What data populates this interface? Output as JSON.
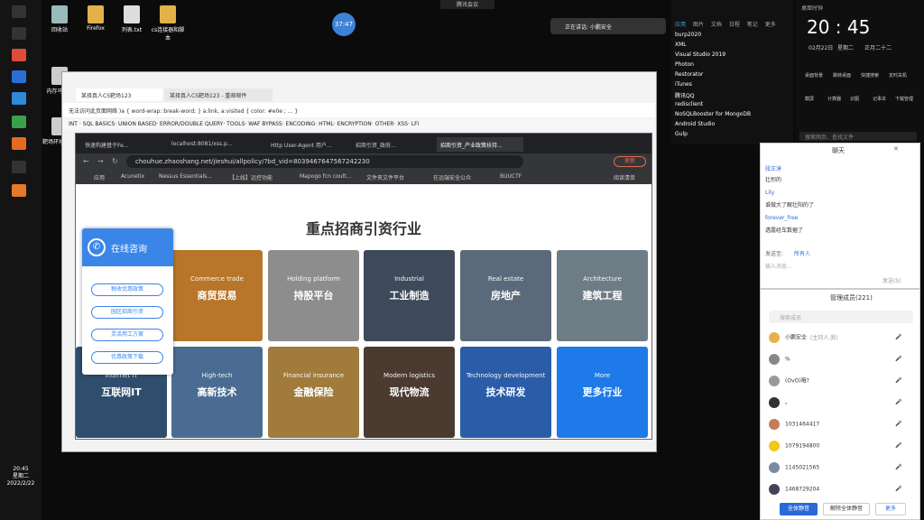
{
  "desktop_icons": [
    "回收站",
    "Firefox",
    "列表.txt",
    "cs连接器和脚本",
    "内存马.jpg",
    "靶场环境\n命令"
  ],
  "tray": {
    "time": "20:45",
    "weekday": "星期二",
    "date": "2022/2/22"
  },
  "meeting": {
    "bar_label": "腾讯会议",
    "timer": "37:47",
    "speaking": "正在讲话: 小鹏安全"
  },
  "outer_browser": {
    "tabs": [
      "某择真人CS靶场123",
      "某择真人CS靶场123 - 重邮邮件"
    ],
    "address": "无法访问此页面网络 )a { word-wrap: break-word; } a:link, a:visited { color: #e0e ; ... }",
    "hackbar": "INT · SQL BASICS· UNION BASED· ERROR/DOUBLE QUERY· TOOLS· WAF BYPASS· ENCODING· HTML· ENCRYPTION· OTHER· XSS· LFI"
  },
  "inner_browser": {
    "tabs": [
      "快速构建基于Fe...",
      "localhost:8081/xss.p...",
      "Http User-Agent 用户...",
      "招商引资_政府...",
      "招商引资_产业政策扶持..."
    ],
    "url": "chouhue.zhaoshang.net/jieshui/allpolicy/?bd_vid=8039467647567242230",
    "bookmarks": [
      "应用",
      "Acunetix",
      "Nessus Essentials...",
      "【上线】远控功能",
      "Mapogo fcn coult...",
      "文件夹文件平台",
      "在远端安全公众",
      "BUUCTF",
      "阅读清单"
    ],
    "update_label": "更新"
  },
  "page": {
    "title": "重点招商引资行业",
    "tiles": [
      {
        "en": "Commerce trade",
        "zh": "商贸贸易",
        "color": "#b8762a"
      },
      {
        "en": "Holding platform",
        "zh": "持股平台",
        "color": "#8d8d8d"
      },
      {
        "en": "Industrial",
        "zh": "工业制造",
        "color": "#3e4a5a"
      },
      {
        "en": "Real estate",
        "zh": "房地产",
        "color": "#5a6a7a"
      },
      {
        "en": "Architecture",
        "zh": "建筑工程",
        "color": "#6e7c86"
      },
      {
        "en": "Internet IT",
        "zh": "互联网IT",
        "color": "#2f4e6e"
      },
      {
        "en": "High-tech",
        "zh": "高新技术",
        "color": "#4a6c92"
      },
      {
        "en": "Financial insurance",
        "zh": "金融保险",
        "color": "#a07b3c"
      },
      {
        "en": "Modern logistics",
        "zh": "现代物流",
        "color": "#4a3a30"
      },
      {
        "en": "Technology development",
        "zh": "技术研发",
        "color": "#2a5ca8"
      },
      {
        "en": "More",
        "zh": "更多行业",
        "color": "#1e7ae8"
      }
    ],
    "consult": {
      "title": "在线咨询",
      "buttons": [
        "税收优惠政策",
        "园区招商引资",
        "灵活用工方案",
        "优惠政策下载"
      ]
    }
  },
  "apps_panel": {
    "tabs": [
      "应用",
      "图片",
      "文档",
      "日程",
      "笔记",
      "更多"
    ],
    "items": [
      "burp2020",
      "XML",
      "Visual Studio 2019",
      "Photon",
      "Restorator",
      "iTunes",
      "腾讯QQ",
      "redisclient",
      "NoSQLBooster for MongoDB",
      "Android Studio",
      "Gulp"
    ]
  },
  "clock_panel": {
    "title": "桌面时钟",
    "time": "20 : 45",
    "date": "02月22日",
    "weekday": "星期二",
    "lunar": "正月二十二",
    "actions": [
      "桌面背景",
      "跳转桌面",
      "快捷搜索",
      "定时关机",
      "截屏",
      "计算器",
      "识图",
      "记事本",
      "下载管理"
    ],
    "search_placeholder": "搜索网页、查找文件"
  },
  "chat": {
    "title": "聊天",
    "messages": [
      {
        "name": "段正淳",
        "text": "壮烈的"
      },
      {
        "name": "Lily",
        "text": "谁做大了解壮阳的了"
      },
      {
        "name": "forever_free",
        "text": "透露经车数据了"
      }
    ],
    "send_to_label": "发送至:",
    "send_to": "所有人",
    "input_placeholder": "输入消息...",
    "send_button": "发送(S)"
  },
  "members": {
    "title": "管理成员(221)",
    "search_placeholder": "搜索成员",
    "rows": [
      {
        "name": "小鹏安全",
        "sub": "(主持人,我)",
        "color": "#e8b04a"
      },
      {
        "name": "%",
        "sub": "",
        "color": "#888"
      },
      {
        "name": "(OvO)哦?",
        "sub": "",
        "color": "#999"
      },
      {
        "name": "。",
        "sub": "",
        "color": "#333"
      },
      {
        "name": "1031464417",
        "sub": "",
        "color": "#c97a5a"
      },
      {
        "name": "1079194800",
        "sub": "",
        "color": "#f5c518"
      },
      {
        "name": "1145021565",
        "sub": "",
        "color": "#7a8aa0"
      },
      {
        "name": "1468729204",
        "sub": "",
        "color": "#445"
      }
    ],
    "buttons": [
      "全体静音",
      "解除全体静音",
      "更多"
    ]
  }
}
